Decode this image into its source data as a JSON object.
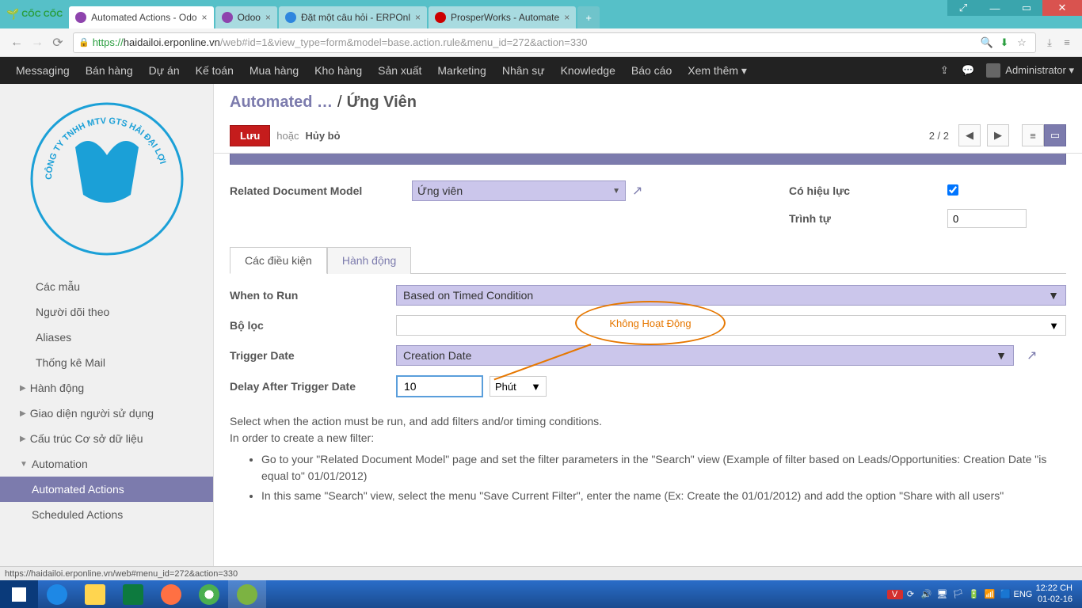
{
  "browser": {
    "tabs": [
      {
        "label": "Automated Actions - Odo",
        "active": true,
        "favicon": "#8e44ad"
      },
      {
        "label": "Odoo",
        "active": false,
        "favicon": "#8e44ad"
      },
      {
        "label": "Đặt một câu hỏi - ERPOnl",
        "active": false,
        "favicon": "#2e86de"
      },
      {
        "label": "ProsperWorks - Automate",
        "active": false,
        "favicon": "#cc0000"
      }
    ],
    "coccoc": "CỐC CỐC",
    "url_https": "https://",
    "url_domain": "haidailoi.erponline.vn",
    "url_path": "/web#id=1&view_type=form&model=base.action.rule&menu_id=272&action=330"
  },
  "odoo_menu": {
    "items": [
      "Messaging",
      "Bán hàng",
      "Dự án",
      "Kế toán",
      "Mua hàng",
      "Kho hàng",
      "Sản xuất",
      "Marketing",
      "Nhân sự",
      "Knowledge",
      "Báo cáo",
      "Xem thêm ▾"
    ],
    "user": "Administrator ▾"
  },
  "sidebar": {
    "items_top": [
      "Các mẫu",
      "Người dõi theo",
      "Aliases",
      "Thống kê Mail"
    ],
    "groups": [
      {
        "label": "Hành động",
        "expanded": false
      },
      {
        "label": "Giao diện người sử dụng",
        "expanded": false
      },
      {
        "label": "Cấu trúc Cơ sở dữ liệu",
        "expanded": false
      },
      {
        "label": "Automation",
        "expanded": true,
        "children": [
          {
            "label": "Automated Actions",
            "active": true
          },
          {
            "label": "Scheduled Actions",
            "active": false
          }
        ]
      }
    ]
  },
  "breadcrumb": {
    "parent": "Automated …",
    "current": "Ứng Viên"
  },
  "actions": {
    "save": "Lưu",
    "or": "hoặc",
    "cancel": "Hủy bỏ",
    "pager": "2 / 2"
  },
  "form": {
    "related_model_label": "Related Document Model",
    "related_model_value": "Ứng viên",
    "active_label": "Có hiệu lực",
    "sequence_label": "Trình tự",
    "sequence_value": "0"
  },
  "tabs": {
    "t1": "Các điều kiện",
    "t2": "Hành động"
  },
  "annotation": "Không Hoạt Động",
  "conditions": {
    "when_label": "When to Run",
    "when_value": "Based on Timed Condition",
    "filter_label": "Bộ lọc",
    "filter_value": "",
    "trigger_label": "Trigger Date",
    "trigger_value": "Creation Date",
    "delay_label": "Delay After Trigger Date",
    "delay_value": "10",
    "delay_unit": "Phút"
  },
  "help": {
    "line1": "Select when the action must be run, and add filters and/or timing conditions.",
    "line2": "In order to create a new filter:",
    "bullet1": "Go to your \"Related Document Model\" page and set the filter parameters in the \"Search\" view (Example of filter based on Leads/Opportunities: Creation Date \"is equal to\" 01/01/2012)",
    "bullet2": "In this same \"Search\" view, select the menu \"Save Current Filter\", enter the name (Ex: Create the 01/01/2012) and add the option \"Share with all users\""
  },
  "status_bar": "https://haidailoi.erponline.vn/web#menu_id=272&action=330",
  "taskbar": {
    "lang": "ENG",
    "time": "12:22 CH",
    "date": "01-02-16"
  }
}
